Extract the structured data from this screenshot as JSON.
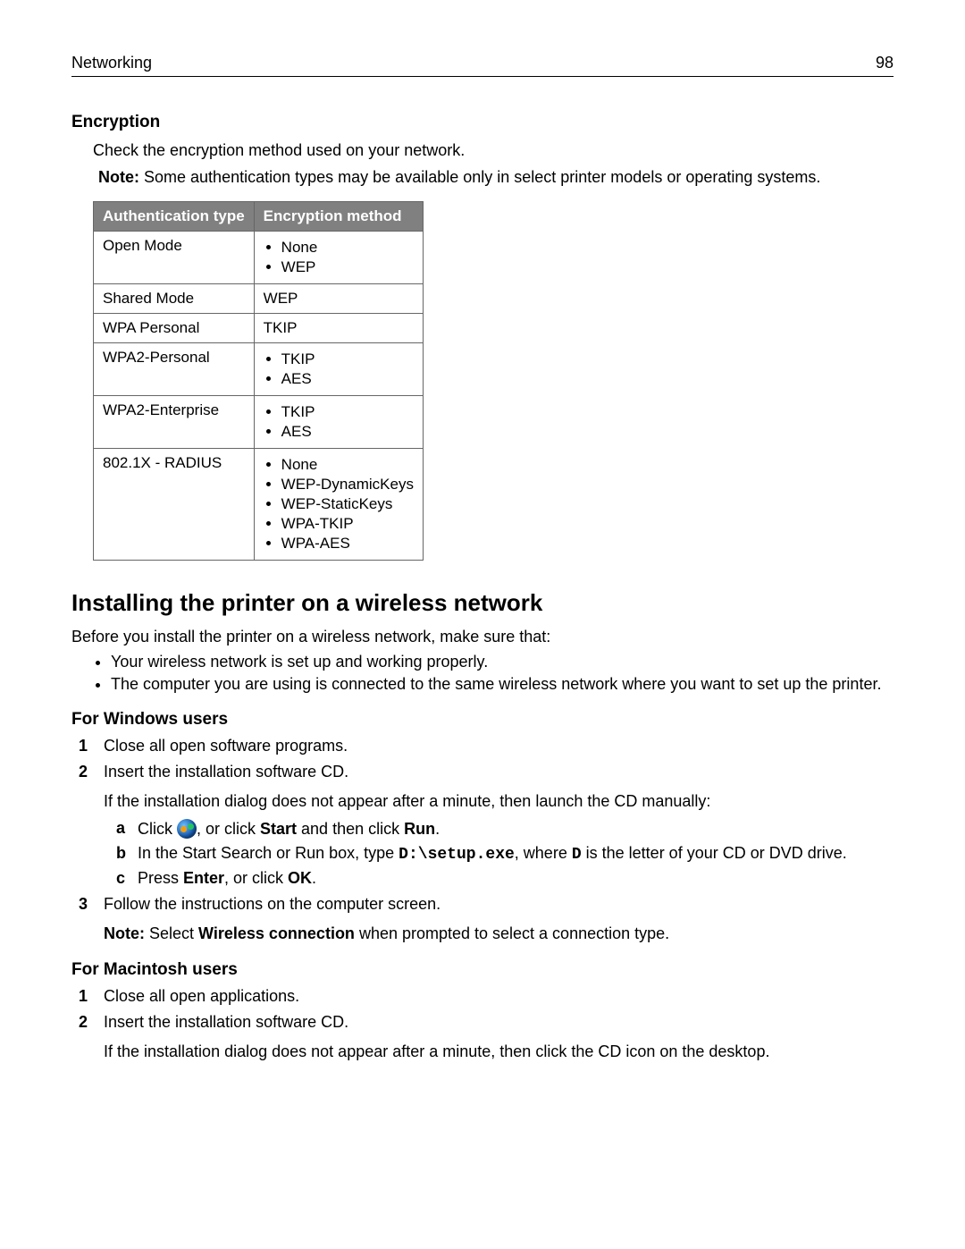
{
  "header": {
    "section": "Networking",
    "page": "98"
  },
  "encryption": {
    "heading": "Encryption",
    "intro": "Check the encryption method used on your network.",
    "note_label": "Note:",
    "note_text": "Some authentication types may be available only in select printer models or operating systems.",
    "table": {
      "col1": "Authentication type",
      "col2": "Encryption method",
      "rows": [
        {
          "auth": "Open Mode",
          "methods": [
            "None",
            "WEP"
          ]
        },
        {
          "auth": "Shared Mode",
          "methods": [
            "WEP"
          ]
        },
        {
          "auth": "WPA Personal",
          "methods": [
            "TKIP"
          ]
        },
        {
          "auth": "WPA2-Personal",
          "methods": [
            "TKIP",
            "AES"
          ]
        },
        {
          "auth": "WPA2-Enterprise",
          "methods": [
            "TKIP",
            "AES"
          ]
        },
        {
          "auth": "802.1X - RADIUS",
          "methods": [
            "None",
            "WEP-DynamicKeys",
            "WEP-StaticKeys",
            "WPA-TKIP",
            "WPA-AES"
          ]
        }
      ]
    }
  },
  "install": {
    "heading": "Installing the printer on a wireless network",
    "intro": "Before you install the printer on a wireless network, make sure that:",
    "prereqs": [
      "Your wireless network is set up and working properly.",
      "The computer you are using is connected to the same wireless network where you want to set up the printer."
    ],
    "windows": {
      "heading": "For Windows users",
      "steps": {
        "s1": "Close all open software programs.",
        "s2": "Insert the installation software CD.",
        "s2_sub": "If the installation dialog does not appear after a minute, then launch the CD manually:",
        "a_pre": "Click ",
        "a_mid": ", or click ",
        "a_start": "Start",
        "a_and": " and then click ",
        "a_run": "Run",
        "a_end": ".",
        "b_pre": "In the Start Search or Run box, type ",
        "b_code": "D:\\setup.exe",
        "b_mid": ", where ",
        "b_drive": "D",
        "b_end": " is the letter of your CD or DVD drive.",
        "c_pre": "Press ",
        "c_enter": "Enter",
        "c_mid": ", or click ",
        "c_ok": "OK",
        "c_end": ".",
        "s3": "Follow the instructions on the computer screen.",
        "s3_note_pre": "Select ",
        "s3_note_bold": "Wireless connection",
        "s3_note_post": " when prompted to select a connection type."
      }
    },
    "mac": {
      "heading": "For Macintosh users",
      "s1": "Close all open applications.",
      "s2": "Insert the installation software CD.",
      "s2_sub": "If the installation dialog does not appear after a minute, then click the CD icon on the desktop."
    }
  }
}
